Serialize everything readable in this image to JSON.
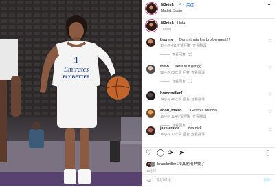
{
  "post": {
    "username": "lil3nick",
    "follow_label": "关注",
    "location": "Madrid, Spain",
    "caption_username": "lil3nick",
    "caption_text": "Hola",
    "caption_time": "18小时"
  },
  "jersey": {
    "number": "1",
    "brand_line1": "Emirates",
    "brand_line2": "FLY BETTER"
  },
  "comments": [
    {
      "username": "bronny",
      "text": "Damn thats fire bro be great!!!",
      "time": "17小时",
      "likes": "411次赞",
      "reply_label": "回复",
      "translate_label": "查看翻译",
      "view_replies": "查看回复（2）"
    },
    {
      "username": "melo",
      "text": "skrill to it gangg",
      "time": "16小时",
      "likes": "62次赞",
      "reply_label": "回复",
      "translate_label": "查看翻译",
      "view_replies": "查看回复（1）"
    },
    {
      "username": "brandmiller1",
      "text": "",
      "time": "14小时",
      "likes": "48次赞",
      "reply_label": "回复",
      "translate_label": "查看翻译",
      "view_replies": ""
    },
    {
      "username": "adou_thiero",
      "text": "Get to it brudda",
      "time": "16小时",
      "likes": "114次赞",
      "reply_label": "回复",
      "translate_label": "查看翻译",
      "view_replies": "查看回复（1）"
    },
    {
      "username": "jakelaravia",
      "text": "Yea nick",
      "time": "16小时",
      "likes": "77次赞",
      "reply_label": "回复",
      "translate_label": "查看翻译",
      "view_replies": ""
    }
  ],
  "liked_by": "brandmiller1和其他用户赞了",
  "post_time": "18小时",
  "add_comment_placeholder": "添加评论...",
  "post_button_label": "发布",
  "colors": {
    "link": "#1d66d6",
    "muted": "#8e8e8e",
    "verified": "#3897f0"
  }
}
